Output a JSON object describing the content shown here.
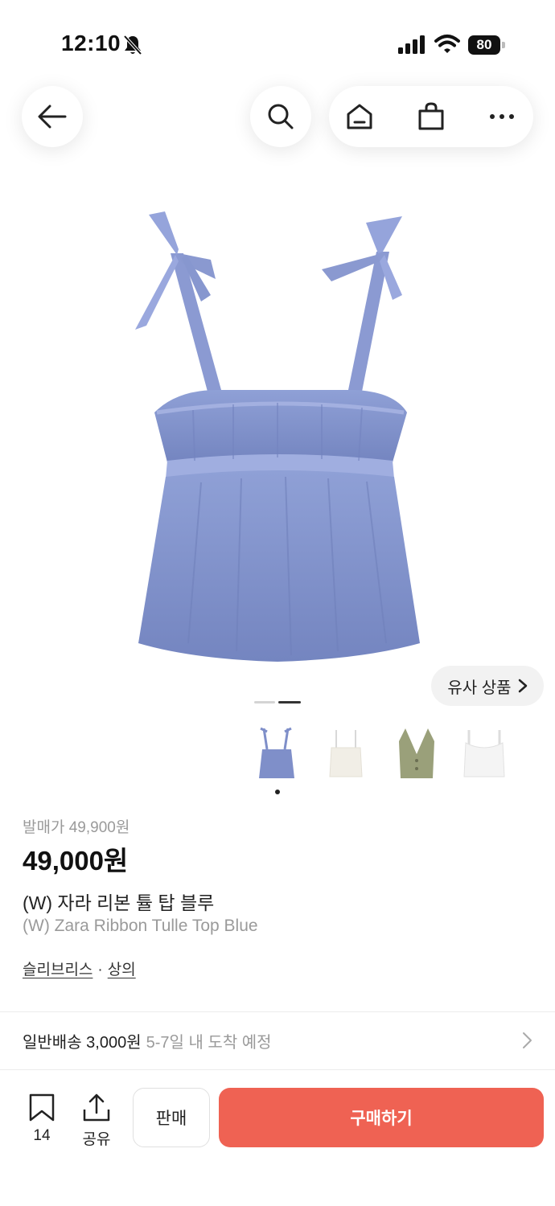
{
  "status_bar": {
    "time": "12:10",
    "battery": "80"
  },
  "similar": {
    "label": "유사 상품",
    "chevron": "›"
  },
  "product": {
    "original_price": "발매가 49,900원",
    "price": "49,000원",
    "title_ko": "(W) 자라 리본 튤 탑 블루",
    "title_en": "(W) Zara Ribbon Tulle Top Blue",
    "category_1": "슬리브리스",
    "category_sep": "·",
    "category_2": "상의",
    "main_color": "#7f8fc9",
    "image_count": 2,
    "image_index": 2
  },
  "thumbnails": [
    {
      "name": "thumb-blue-tulle-top",
      "color": "#7f8fc9"
    },
    {
      "name": "thumb-white-cami",
      "color": "#f1eee6"
    },
    {
      "name": "thumb-khaki-vest",
      "color": "#9aa07a"
    },
    {
      "name": "thumb-white-top",
      "color": "#f4f4f4"
    }
  ],
  "shipping": {
    "main": "일반배송 3,000원",
    "sub": "5-7일 내 도착 예정"
  },
  "bottom": {
    "save_count": "14",
    "share_label": "공유",
    "sell_label": "판매",
    "buy_label": "구매하기"
  },
  "colors": {
    "accent": "#ef6253"
  },
  "icons": [
    "back-arrow-icon",
    "search-icon",
    "home-icon",
    "shopping-bag-icon",
    "more-icon",
    "bookmark-icon",
    "share-icon",
    "chevron-right-icon"
  ]
}
